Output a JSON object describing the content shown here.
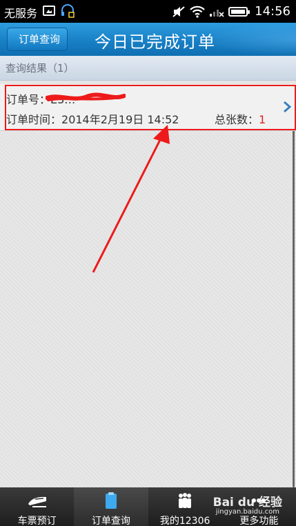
{
  "status_bar": {
    "carrier": "无服务",
    "time": "14:56"
  },
  "header": {
    "back_label": "订单查询",
    "title": "今日已完成订单"
  },
  "results": {
    "header": "查询结果（1）"
  },
  "order": {
    "number_label": "订单号：",
    "number_value": "E3…",
    "time_label": "订单时间：",
    "time_value": "2014年2月19日 14:52",
    "count_label": "总张数：",
    "count_value": "1"
  },
  "bottom_nav": {
    "items": [
      {
        "label": "车票预订",
        "icon": "train-icon"
      },
      {
        "label": "订单查询",
        "icon": "clipboard-icon"
      },
      {
        "label": "我的12306",
        "icon": "people-icon"
      },
      {
        "label": "更多功能",
        "icon": "more-icon"
      }
    ],
    "active_index": 1
  },
  "watermark": {
    "brand": "Bai du 经验",
    "url": "jingyan.baidu.com"
  },
  "colors": {
    "title_bar": "#1a82c8",
    "annotation_red": "#ee1a1a",
    "count_value": "#d22222"
  }
}
